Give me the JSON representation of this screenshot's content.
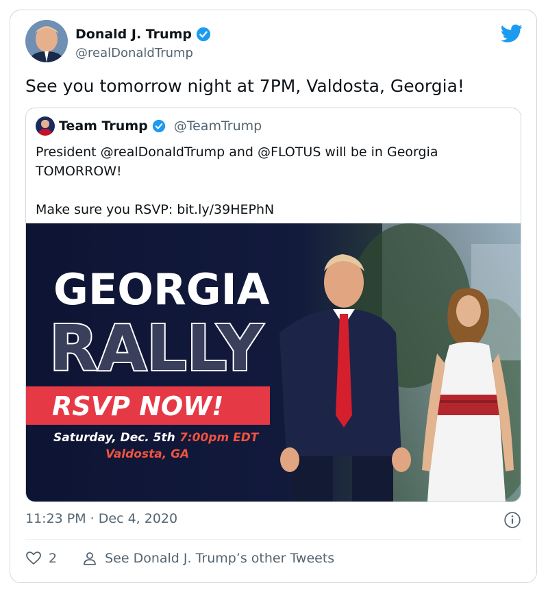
{
  "author": {
    "name": "Donald J. Trump",
    "handle": "@realDonaldTrump"
  },
  "tweet": {
    "text": "See you tomorrow night at 7PM, Valdosta, Georgia!",
    "timestamp": "11:23 PM · Dec 4, 2020",
    "like_count": "2",
    "other_tweets_label": "See Donald J. Trump’s other Tweets"
  },
  "quoted": {
    "name": "Team Trump",
    "handle": "@TeamTrump",
    "text": "President @realDonaldTrump and @FLOTUS will be in Georgia TOMORROW!\n\nMake sure you RSVP: bit.ly/39HEPhN"
  },
  "media": {
    "headline1": "GEORGIA",
    "headline2": "RALLY",
    "cta": "RSVP NOW!",
    "date": "Saturday, Dec. 5th",
    "time": "7:00pm EDT",
    "location": "Valdosta, GA"
  },
  "colors": {
    "twitter_blue": "#1d9bf0",
    "navy": "#141a3a",
    "red_banner": "#e63946",
    "accent_red": "#f0533f"
  },
  "icons": [
    "verified-icon",
    "twitter-bird-icon",
    "info-icon",
    "heart-icon",
    "person-icon"
  ]
}
